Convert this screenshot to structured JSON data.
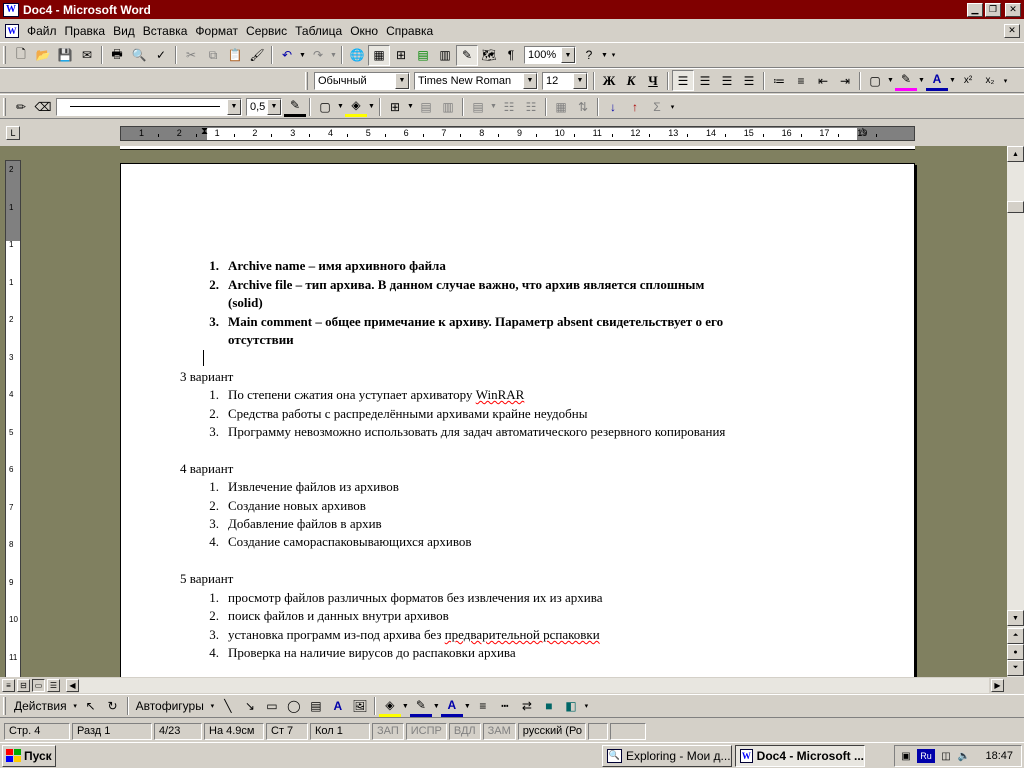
{
  "window": {
    "title": "Doc4 - Microsoft Word",
    "app_icon": "W"
  },
  "menu": [
    "Файл",
    "Правка",
    "Вид",
    "Вставка",
    "Формат",
    "Сервис",
    "Таблица",
    "Окно",
    "Справка"
  ],
  "toolbar_standard": {
    "zoom": "100%"
  },
  "toolbar_formatting": {
    "style": "Обычный",
    "font": "Times New Roman",
    "size": "12",
    "bold": "Ж",
    "italic": "К",
    "underline": "Ч"
  },
  "toolbar_tables": {
    "line_weight": "0,5"
  },
  "ruler": {
    "numbers": [
      "1",
      "2",
      "1",
      "2",
      "3",
      "4",
      "5",
      "6",
      "7",
      "8",
      "9",
      "10",
      "11",
      "12",
      "13",
      "14",
      "15",
      "16",
      "17",
      "19"
    ],
    "vnumbers": [
      "2",
      "1",
      "1",
      "1",
      "2",
      "3",
      "4",
      "5",
      "6",
      "7",
      "8",
      "9",
      "10",
      "11"
    ]
  },
  "document": {
    "bold_list": [
      {
        "num": "1.",
        "lines": [
          "Archive name – имя архивного файла"
        ]
      },
      {
        "num": "2.",
        "lines": [
          "Archive file – тип архива. В данном случае важно, что архив является сплошным",
          "(solid)"
        ]
      },
      {
        "num": "3.",
        "lines": [
          "Main comment – общее примечание к архиву. Параметр absent свидетельствует о его",
          "отсутствии"
        ]
      }
    ],
    "sections": [
      {
        "heading": "3 вариант",
        "items": [
          {
            "num": "1.",
            "text": "По степени сжатия она уступает архиватору ",
            "squiggle": "WinRAR"
          },
          {
            "num": "2.",
            "text": "Средства работы с распределёнными архивами крайне неудобны"
          },
          {
            "num": "3.",
            "text": "Программу невозможно использовать для задач автоматического резервного копирования"
          }
        ]
      },
      {
        "heading": "4 вариант",
        "items": [
          {
            "num": "1.",
            "text": "Извлечение файлов из архивов"
          },
          {
            "num": "2.",
            "text": "Создание новых архивов"
          },
          {
            "num": "3.",
            "text": "Добавление файлов в архив"
          },
          {
            "num": "4.",
            "text": "Создание самораспаковывающихся архивов"
          }
        ]
      },
      {
        "heading": "5 вариант",
        "items": [
          {
            "num": "1.",
            "text": "просмотр файлов различных форматов без извлечения их из архива"
          },
          {
            "num": "2.",
            "text": "поиск файлов и данных внутри архивов"
          },
          {
            "num": "3.",
            "text": "установка программ из-под архива без ",
            "squiggle": "предварительной рспаковки"
          },
          {
            "num": "4.",
            "text": "Проверка на наличие вирусов до распаковки архива"
          }
        ]
      }
    ]
  },
  "drawing_toolbar": {
    "actions": "Действия",
    "autoshapes": "Автофигуры"
  },
  "status": {
    "page": "Стр. 4",
    "section": "Разд 1",
    "pages": "4/23",
    "position": "На 4.9см",
    "line": "Ст 7",
    "column": "Кол 1",
    "rec": "ЗАП",
    "trk": "ИСПР",
    "ext": "ВДЛ",
    "ovr": "ЗАМ",
    "language": "русский (Ро"
  },
  "taskbar": {
    "start": "Пуск",
    "tasks": [
      "Exploring - Мои д...",
      "Doc4 - Microsoft ..."
    ],
    "lang": "Ru",
    "clock": "18:47"
  }
}
